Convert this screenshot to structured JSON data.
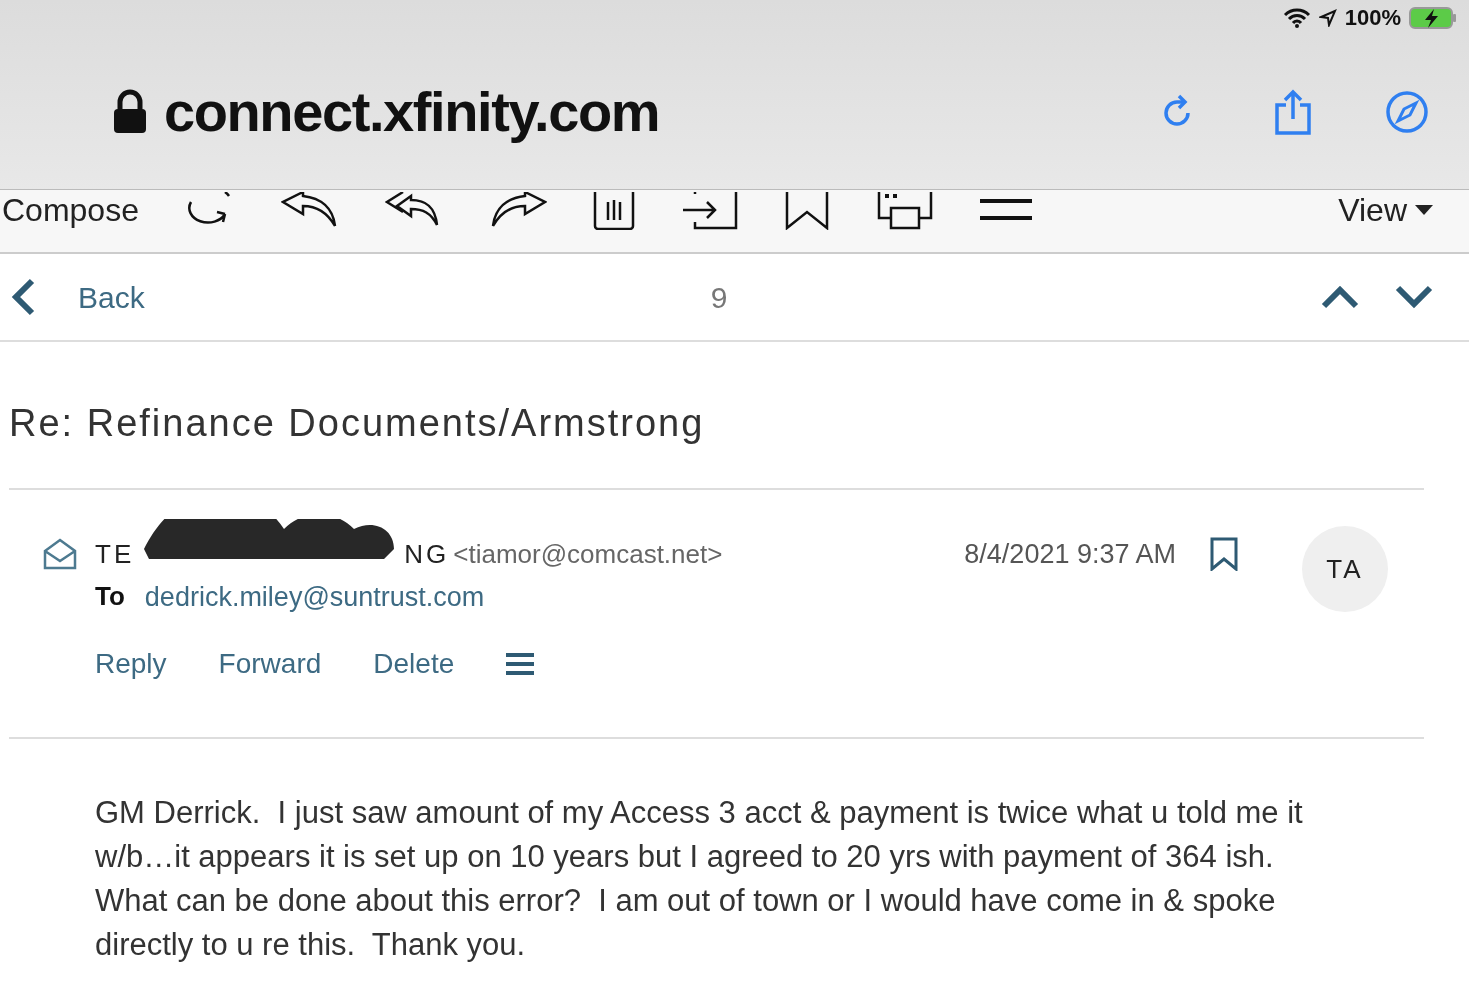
{
  "status_bar": {
    "battery": "100%"
  },
  "address_bar": {
    "url": "connect.xfinity.com"
  },
  "toolbar": {
    "compose": "Compose",
    "view": "View"
  },
  "nav": {
    "back": "Back",
    "count": "9"
  },
  "message": {
    "subject": "Re: Refinance Documents/Armstrong",
    "sender_visible_start": "TE",
    "sender_visible_end": "NG",
    "sender_email": "<tiamor@comcast.net>",
    "date": "8/4/2021 9:37 AM",
    "avatar": "TA",
    "to_label": "To",
    "to": "dedrick.miley@suntrust.com",
    "actions": [
      "Reply",
      "Forward",
      "Delete"
    ],
    "body": "GM Derrick.  I just saw amount of my Access 3 acct & payment is twice what u told me it w/b…it appears it is set up on 10 years but I agreed to 20 yrs with payment of 364 ish.  What can be done about this error?  I am out of town or I would have come in & spoke directly to u re this.  Thank you."
  }
}
